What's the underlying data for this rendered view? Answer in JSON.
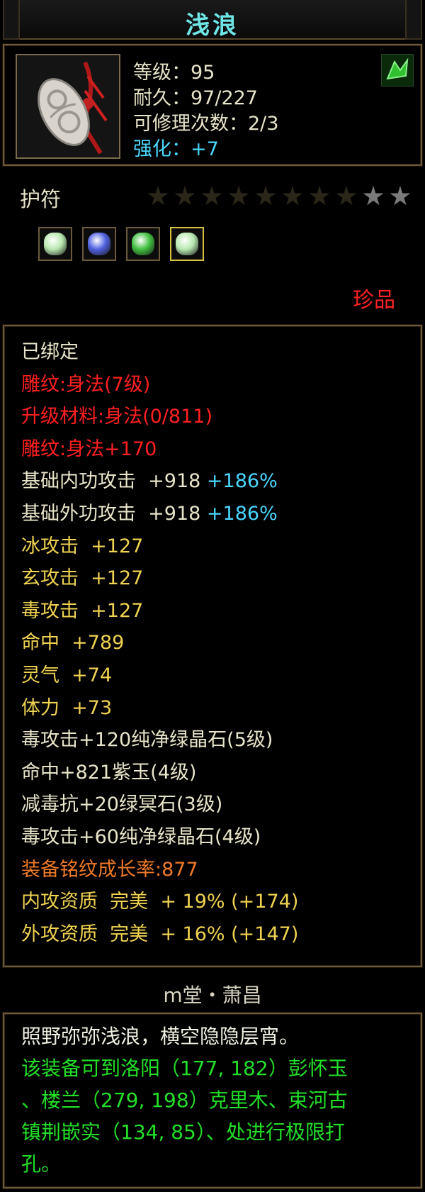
{
  "item": {
    "title": "浅浪",
    "level_label": "等级：95",
    "durability_label": "耐久：97/227",
    "repair_label": "可修理次数：2/3",
    "enhance_label": "强化：+7",
    "type": "护符",
    "stars_total": 10,
    "stars_lit": 2,
    "rarity": "珍品"
  },
  "gems": [
    {
      "name": "pure-green-crystal",
      "color": "#b8e8b0"
    },
    {
      "name": "purple-jade",
      "color": "#5060e0"
    },
    {
      "name": "green-dark-stone",
      "color": "#40c040"
    },
    {
      "name": "pure-green-crystal",
      "color": "#b8e8b0"
    }
  ],
  "stats": [
    {
      "a": "已绑定",
      "color": "white"
    },
    {
      "a": "雕纹:身法(7级)",
      "color": "red"
    },
    {
      "a": "升级材料:身法(0/811)",
      "color": "red"
    },
    {
      "a": "雕纹:身法+170",
      "color": "red"
    },
    {
      "a": "基础内功攻击  +918 ",
      "b": "+186%",
      "color": "white"
    },
    {
      "a": "基础外功攻击  +918 ",
      "b": "+186%",
      "color": "white"
    },
    {
      "a": "冰攻击  +127",
      "color": "yellow"
    },
    {
      "a": "玄攻击  +127",
      "color": "yellow"
    },
    {
      "a": "毒攻击  +127",
      "color": "yellow"
    },
    {
      "a": "命中  +789",
      "color": "yellow"
    },
    {
      "a": "灵气  +74",
      "color": "yellow"
    },
    {
      "a": "体力  +73",
      "color": "yellow"
    },
    {
      "a": "毒攻击+120纯净绿晶石(5级)",
      "color": "white"
    },
    {
      "a": "命中+821紫玉(4级)",
      "color": "white"
    },
    {
      "a": "减毒抗+20绿冥石(3级)",
      "color": "white"
    },
    {
      "a": "毒攻击+60纯净绿晶石(4级)",
      "color": "white"
    },
    {
      "a": "装备铭纹成长率:877",
      "color": "orange"
    },
    {
      "a": "内攻资质  完美  + 19% (+174)",
      "color": "yellow"
    },
    {
      "a": "外攻资质  完美  + 16% (+147)",
      "color": "yellow"
    }
  ],
  "set_name": "m堂・萧昌",
  "description": [
    {
      "text": "照野弥弥浅浪，横空隐隐层宵。",
      "color": "white"
    },
    {
      "text": "该装备可到洛阳（177, 182）彭怀玉",
      "color": "green"
    },
    {
      "text": "、楼兰（279, 198）克里木、束河古",
      "color": "green"
    },
    {
      "text": "镇荆嵌实（134, 85）、处进行极限打",
      "color": "green"
    },
    {
      "text": "孔。",
      "color": "green"
    }
  ]
}
